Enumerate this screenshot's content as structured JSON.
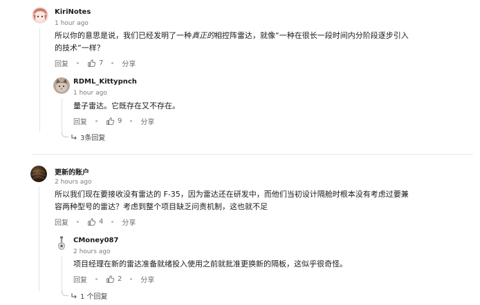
{
  "comments": [
    {
      "username": "KiriNotes",
      "time": "1 hour ago",
      "text_part1": "所以你的意思是说，我们已经发明了一种",
      "text_em": "真正的",
      "text_part2": "相控阵雷达，就像“一种在很长一段时间内分阶段逐步引入",
      "text_line2": "的技术”一样？",
      "reply_label": "回复",
      "votes": "7",
      "share_label": "分享",
      "avatar_icon": "anime-girl-avatar-icon",
      "reply": {
        "username": "RDML_Kittypnch",
        "time": "1 hour ago",
        "text": "量子雷达。它既存在又不存在。",
        "reply_label": "回复",
        "votes": "9",
        "share_label": "分享",
        "avatar_icon": "cat-avatar-icon"
      },
      "more_replies": "3条回复"
    },
    {
      "username": "更新的账户",
      "time": "2 hours ago",
      "text_line1": "所以我们现在要接收没有雷达的 F-35，因为雷达还在研发中，而他们当初设计隔舱时根本没有考虑过要兼",
      "text_line2": "容两种型号的雷达？考虑到整个项目缺乏问责机制，这也就不足",
      "reply_label": "回复",
      "votes": "4",
      "share_label": "分享",
      "avatar_icon": "sphere-avatar-icon",
      "reply": {
        "username": "CMoney087",
        "time": "2 hours ago",
        "text": "项目经理在新的雷达准备就绪投入使用之前就批准更换新的隔板，这似乎很奇怪。",
        "reply_label": "回复",
        "votes": "2",
        "share_label": "分享",
        "avatar_icon": "guitar-avatar-icon"
      },
      "more_replies": "1 个回复"
    }
  ],
  "colors": {
    "text": "#1a1a1b",
    "muted": "#7c7c7c",
    "thread_line": "#e2e2e2"
  }
}
